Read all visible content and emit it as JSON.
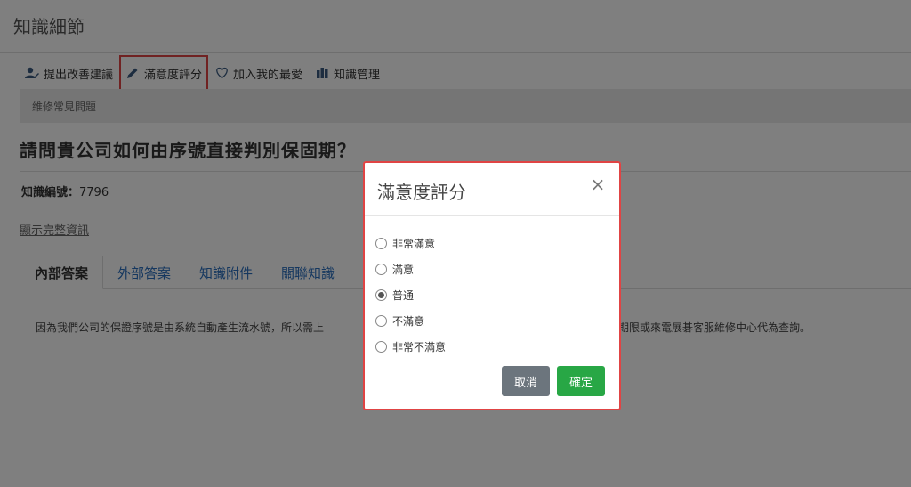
{
  "header": {
    "title": "知識細節"
  },
  "toolbar": {
    "items": [
      {
        "label": "提出改善建議",
        "icon": "user-edit-icon"
      },
      {
        "label": "滿意度評分",
        "icon": "pencil-icon"
      },
      {
        "label": "加入我的最愛",
        "icon": "heart-icon"
      },
      {
        "label": "知識管理",
        "icon": "books-icon"
      }
    ]
  },
  "breadcrumb": "維修常見問題",
  "question": {
    "title": "請問貴公司如何由序號直接判別保固期？"
  },
  "knowledge": {
    "id_label": "知識編號：",
    "id_value": "7796"
  },
  "show_full_info": "顯示完整資訊",
  "tabs": [
    {
      "label": "內部答案"
    },
    {
      "label": "外部答案"
    },
    {
      "label": "知識附件"
    },
    {
      "label": "關聯知識"
    }
  ],
  "answer": {
    "left": "因為我們公司的保證序號是由系統自動產生流水號，所以需上",
    "right": "如保固期限或來電展碁客服維修中心代為查詢。"
  },
  "modal": {
    "title": "滿意度評分",
    "close": "×",
    "options": [
      "非常滿意",
      "滿意",
      "普通",
      "不滿意",
      "非常不滿意"
    ],
    "selected_index": 2,
    "cancel_label": "取消",
    "ok_label": "確定"
  },
  "colors": {
    "highlight": "#e04444",
    "link": "#2a6fbf",
    "cancel": "#6c757d",
    "ok": "#28a745"
  }
}
